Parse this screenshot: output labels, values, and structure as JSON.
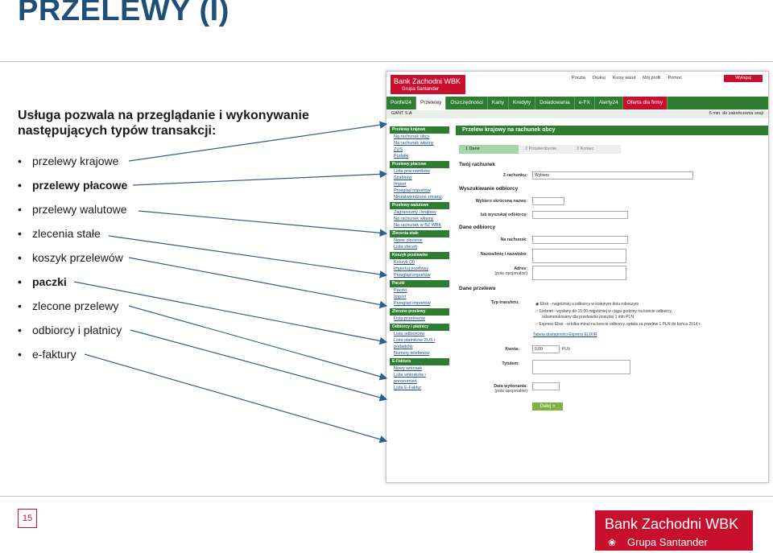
{
  "slide": {
    "title": "PRZELEWY (I)",
    "intro": "Usługa pozwala na przeglądanie i wykonywanie następujących typów transakcji:",
    "bullet_char": "•",
    "bullets": [
      {
        "text": "przelewy krajowe"
      },
      {
        "text": "przelewy płacowe"
      },
      {
        "text": "przelewy walutowe"
      },
      {
        "text": "zlecenia stałe"
      },
      {
        "text": "koszyk przelewów"
      },
      {
        "text": "paczki"
      },
      {
        "text": "zlecone przelewy"
      },
      {
        "text": "odbiorcy i płatnicy"
      },
      {
        "text": "e-faktury"
      }
    ],
    "page_number": "15"
  },
  "logo": {
    "line1": "Bank Zachodni WBK",
    "line2": "Grupa Santander"
  },
  "screenshot": {
    "logo1": "Bank Zachodni WBK",
    "logo2": "Grupa Santander",
    "top_links": [
      "Poczta",
      "Drukuj",
      "Kursy walut",
      "Mój profil",
      "Pomoc"
    ],
    "logout": "Wyloguj",
    "nav": [
      "Portfel24",
      "Przelewy",
      "Oszczędności",
      "Karty",
      "Kredyty",
      "Doładowania",
      "e-FX",
      "Alerty24",
      "Oferta dla firmy"
    ],
    "user": "GANT S.A",
    "timer": "5 min. do zakończenia sesji",
    "side": {
      "krajowe": "Przelewy krajowe",
      "k1": "Na rachunek obcy",
      "k2": "Na rachunek własny",
      "k3": "ZUS",
      "k4": "Podatki",
      "placowe": "Przelewy płacowe",
      "p1": "Lista pracowników",
      "p2": "Szablony",
      "p3": "Import",
      "p4": "Przegląd importów",
      "p5": "Niezatwierdzone zmiany",
      "walutowe": "Przelewy walutowe",
      "w1": "Zagraniczny i krajowy",
      "w2": "Na rachunek własny",
      "w3": "Na rachunek w BZ WBK",
      "zlecenia": "Zlecenia stałe",
      "z1": "Nowe zlecenie",
      "z2": "Lista zleceń",
      "koszyk": "Koszyk przelewów",
      "ko1": "Koszyk (3)",
      "ko2": "Importuj przelewy",
      "ko3": "Przegląd importów",
      "paczki": "Paczki",
      "pa1": "Paczki",
      "pa2": "Import",
      "pa3": "Przegląd importów",
      "zlecone": "Zlecone przelewy",
      "zl1": "Lista przelewów",
      "odbiorcy": "Odbiorcy i płatnicy",
      "o1": "Lista odbiorców",
      "o2": "Lista płatników ZUS i podatków",
      "o3": "Numery telefonów",
      "efaktura": "E-Faktura",
      "e1": "Nowy wniosek",
      "e2": "Lista wniosków i porozumień",
      "e3": "Lista E-Faktur"
    },
    "main_title": "Przelew krajowy na rachunek obcy",
    "steps": [
      "1 Dane",
      "2 Potwierdzenie",
      "3 Koniec"
    ],
    "sec_rachunek": "Twój rachunek",
    "lbl_z_rachunku": "Z rachunku:",
    "val_wybierz": "Wybierz",
    "sec_wyszukiwanie": "Wyszukiwanie odbiorcy",
    "lbl_skrocona": "Wybierz skróconą nazwę:",
    "lbl_lub": "lub wyszukaj odbiorcę:",
    "sec_odbiorcy": "Dane odbiorcy",
    "lbl_rachunek": "Na rachunek:",
    "lbl_nazwa": "Nazwa/Imię i nazwisko:",
    "lbl_adres": "Adres:",
    "lbl_opc": "(pole opcjonalne)",
    "sec_przelewu": "Dane przelewu",
    "lbl_typ": "Typ transferu:",
    "radio1": "Elixir - najpóźniej u odbiorcy w kolejnym dniu roboczym",
    "radio2a": "Sorbnet - wysłany do 15:00 najpóźniej w ciągu godziny na koncie odbiorcy,",
    "radio2b": "rekomendowany dla przelewów powyżej 1 mln PLN",
    "radio3": "Express Elixir - w kilka minut na koncie odbiorcy, opłata za przelew 1 PLN do końca 2014 r.",
    "tabela": "Tabela dostępności Express ELIXIR",
    "lbl_kwota": "Kwota:",
    "val_kwota": "0,00",
    "val_pln": "PLN",
    "lbl_tytul": "Tytułem:",
    "lbl_data": "Data wykonania:",
    "dalej": "Dalej »"
  }
}
